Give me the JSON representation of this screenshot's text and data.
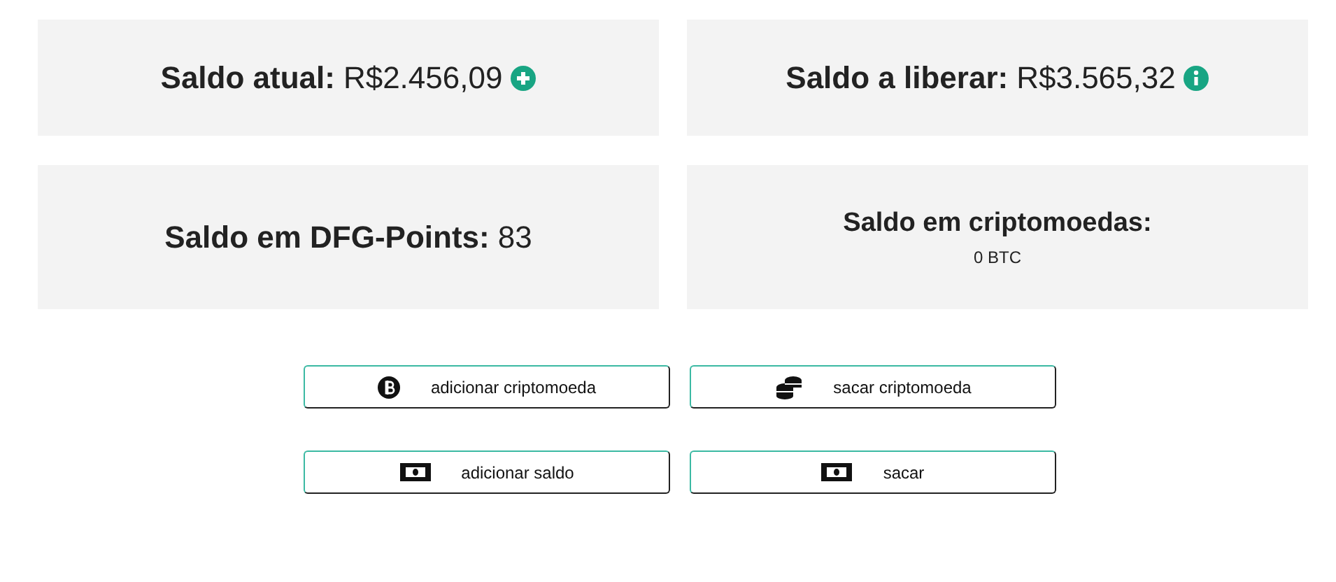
{
  "balances": [
    {
      "kind": "add",
      "label": "Saldo atual:",
      "value": "R$2.456,09"
    },
    {
      "kind": "info",
      "label": "Saldo a liberar:",
      "value": "R$3.565,32"
    },
    {
      "kind": "plain",
      "label": "Saldo em DFG-Points:",
      "value": "83"
    },
    {
      "kind": "stacked",
      "label": "Saldo em criptomoedas:",
      "value": "0 BTC"
    }
  ],
  "actions": [
    {
      "kind": "bitcoin",
      "label": "adicionar criptomoeda"
    },
    {
      "kind": "coins",
      "label": "sacar criptomoeda"
    },
    {
      "kind": "cash",
      "label": "adicionar saldo"
    },
    {
      "kind": "cash",
      "label": "sacar"
    }
  ]
}
